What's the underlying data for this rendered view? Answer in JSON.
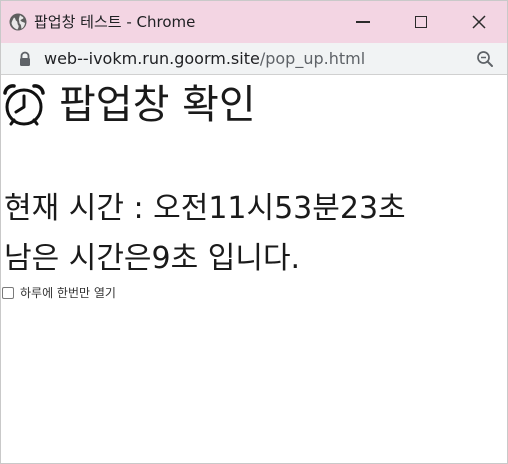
{
  "window": {
    "title": "팝업창 테스트 - Chrome"
  },
  "address": {
    "host": "web--ivokm.run.goorm.site",
    "path": "/pop_up.html"
  },
  "page": {
    "heading": "팝업창 확인",
    "current_time": "현재 시간 : 오전11시53분23초",
    "remaining": "남은 시간은9초 입니다.",
    "checkbox_label": "하루에 한번만 열기",
    "checkbox_checked": false
  },
  "icons": {
    "site": "globe-icon",
    "secure": "lock-icon",
    "zoom": "zoom-icon",
    "heading": "alarm-clock-icon"
  },
  "colors": {
    "titlebar": "#f3d5e3",
    "addressbar": "#f1f3f4"
  }
}
